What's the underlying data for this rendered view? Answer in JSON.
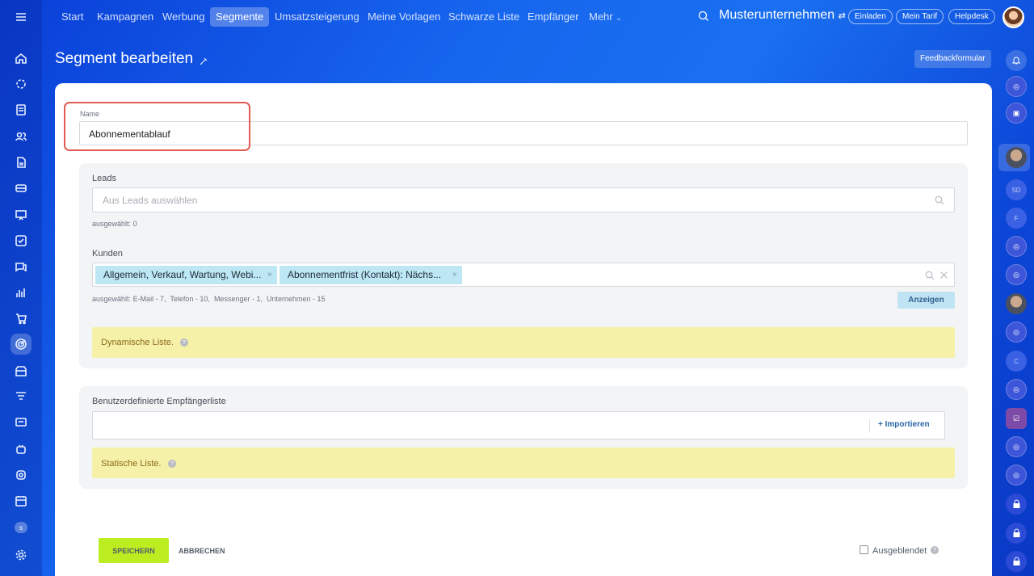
{
  "nav": {
    "items": [
      "Start",
      "Kampagnen",
      "Werbung",
      "Segmente",
      "Umsatzsteigerung",
      "Meine Vorlagen",
      "Schwarze Liste",
      "Empfänger",
      "Mehr"
    ],
    "active": "Segmente",
    "company": "Musterunternehmen",
    "invite_label": "Einladen",
    "plan_label": "Mein Tarif",
    "helpdesk_label": "Helpdesk"
  },
  "left_sidebar": {
    "icons": [
      "menu-icon",
      "home-icon",
      "puzzle-icon",
      "document-icon",
      "contacts-icon",
      "file-icon",
      "card-icon",
      "presentation-icon",
      "tasks-icon",
      "chat-icon",
      "analytics-icon",
      "cart-icon",
      "marketing-icon",
      "store-icon",
      "funnel-icon",
      "screen-icon",
      "robot-icon",
      "shield-icon",
      "calendar-icon",
      "settings-icon"
    ],
    "badge_letter": "s"
  },
  "page": {
    "title": "Segment bearbeiten",
    "feedback_label": "Feedbackformular"
  },
  "form": {
    "name_label": "Name",
    "name_value": "Abonnementablauf",
    "leads": {
      "label": "Leads",
      "placeholder": "Aus Leads auswählen",
      "selected_label": "ausgewählt:",
      "selected_count": "0"
    },
    "customers": {
      "label": "Kunden",
      "tags": [
        "Allgemein, Verkauf, Wartung, Webi...",
        "Abonnementfrist (Kontakt): Nächs..."
      ],
      "selected_label": "ausgewählt:",
      "selected_counts": "E-Mail - 7,  Telefon - 10,  Messenger - 1,  Unternehmen - 15",
      "show_label": "Anzeigen"
    },
    "dynamic_note": "Dynamische Liste.",
    "custom_list": {
      "label": "Benutzerdefinierte Empfängerliste",
      "import_label": "+ Importieren"
    },
    "static_note": "Statische Liste.",
    "save_label": "SPEICHERN",
    "cancel_label": "ABBRECHEN",
    "hidden_label": "Ausgeblendet"
  },
  "right_sidebar": {
    "letters": [
      "SD",
      "F",
      "C"
    ]
  },
  "colors": {
    "background_blue": "#1766ee",
    "save_green": "#bbed21",
    "tag_blue": "#bde7f5",
    "note_yellow": "#f6f1a8",
    "highlight_red": "#e05b52"
  }
}
